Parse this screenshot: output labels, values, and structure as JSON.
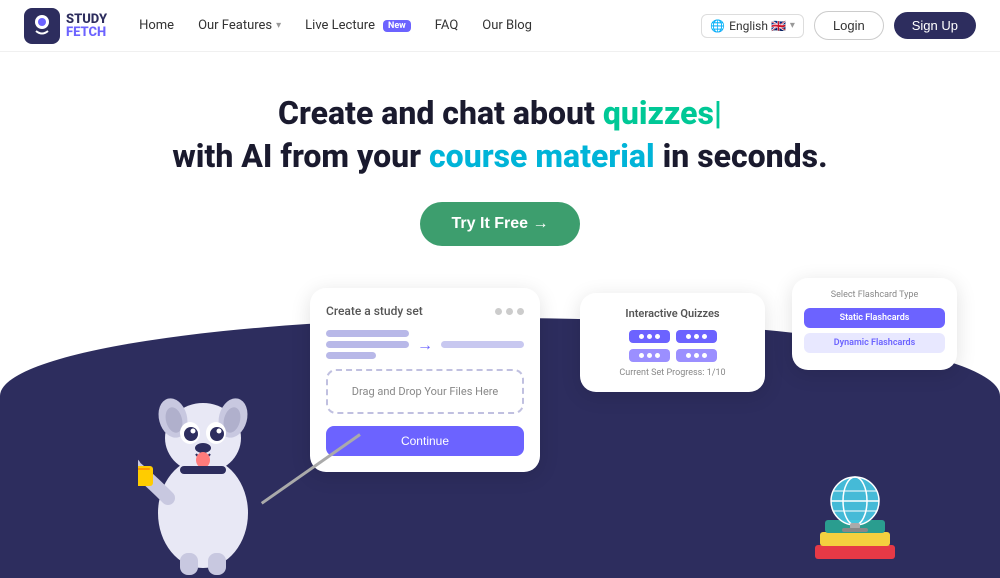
{
  "navbar": {
    "logo_study": "STUDY",
    "logo_fetch": "FETCH",
    "links": [
      {
        "label": "Home",
        "has_dropdown": false
      },
      {
        "label": "Our Features",
        "has_dropdown": true
      },
      {
        "label": "Live Lecture",
        "has_dropdown": false,
        "badge": "New"
      },
      {
        "label": "FAQ",
        "has_dropdown": false
      },
      {
        "label": "Our Blog",
        "has_dropdown": false
      }
    ],
    "lang": "English 🇬🇧",
    "login_label": "Login",
    "signup_label": "Sign Up"
  },
  "hero": {
    "title_part1": "Create and chat about ",
    "title_green": "quizzes|",
    "title_part2": " with AI from your ",
    "title_blue": "course material",
    "title_part3": " in seconds.",
    "cta_label": "Try It Free →"
  },
  "card_study": {
    "title": "Create a study set",
    "drop_label": "Drag and Drop Your Files Here",
    "continue_label": "Continue"
  },
  "card_quiz": {
    "title": "Interactive Quizzes",
    "progress_text": "Current Set Progress: 1/10"
  },
  "card_flashcard": {
    "title": "Select Flashcard Type",
    "option1": "Static Flashcards",
    "option2": "Dynamic Flashcards"
  },
  "icons": {
    "chevron_down": "▾",
    "arrow_right": "→"
  }
}
